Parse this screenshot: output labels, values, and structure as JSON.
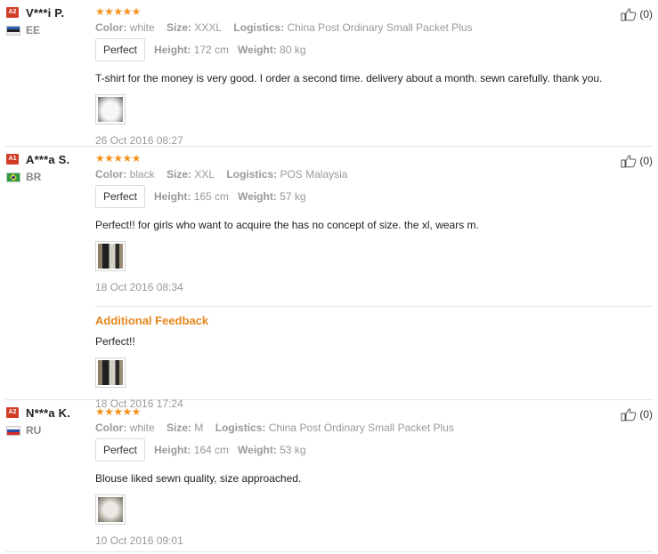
{
  "reviews": [
    {
      "level": "A2",
      "name": "V***i P.",
      "country": "EE",
      "stars": "★★★★★",
      "color_key": "Color:",
      "color": "white",
      "size_key": "Size:",
      "size": "XXXL",
      "logistics_key": "Logistics:",
      "logistics": "China Post Ordinary Small Packet Plus",
      "fit": "Perfect",
      "height_key": "Height:",
      "height": "172 cm",
      "weight_key": "Weight:",
      "weight": "80 kg",
      "text": "T-shirt for the money is very good. I order a second time. delivery about a month. sewn carefully. thank you.",
      "date": "26 Oct 2016 08:27",
      "helpful": "(0)"
    },
    {
      "level": "A1",
      "name": "A***a S.",
      "country": "BR",
      "stars": "★★★★★",
      "color_key": "Color:",
      "color": "black",
      "size_key": "Size:",
      "size": "XXL",
      "logistics_key": "Logistics:",
      "logistics": "POS Malaysia",
      "fit": "Perfect",
      "height_key": "Height:",
      "height": "165 cm",
      "weight_key": "Weight:",
      "weight": "57 kg",
      "text": "Perfect!! for girls who want to acquire the has no concept of size. the xl, wears m.",
      "date": "18 Oct 2016 08:34",
      "helpful": "(0)",
      "additional": {
        "title": "Additional Feedback",
        "text": "Perfect!!",
        "date": "18 Oct 2016 17:24"
      }
    },
    {
      "level": "A2",
      "name": "N***a K.",
      "country": "RU",
      "stars": "★★★★★",
      "color_key": "Color:",
      "color": "white",
      "size_key": "Size:",
      "size": "M",
      "logistics_key": "Logistics:",
      "logistics": "China Post Ordinary Small Packet Plus",
      "fit": "Perfect",
      "height_key": "Height:",
      "height": "164 cm",
      "weight_key": "Weight:",
      "weight": "53 kg",
      "text": "Blouse liked sewn quality, size approached.",
      "date": "10 Oct 2016 09:01",
      "helpful": "(0)"
    }
  ],
  "colors": {
    "star": "#f2941e",
    "additional_title": "#e6871e",
    "level_badge": "#d23d26",
    "muted": "#999999"
  },
  "icons": {
    "level": "level-badge",
    "thumb": "thumbs-up-icon"
  }
}
